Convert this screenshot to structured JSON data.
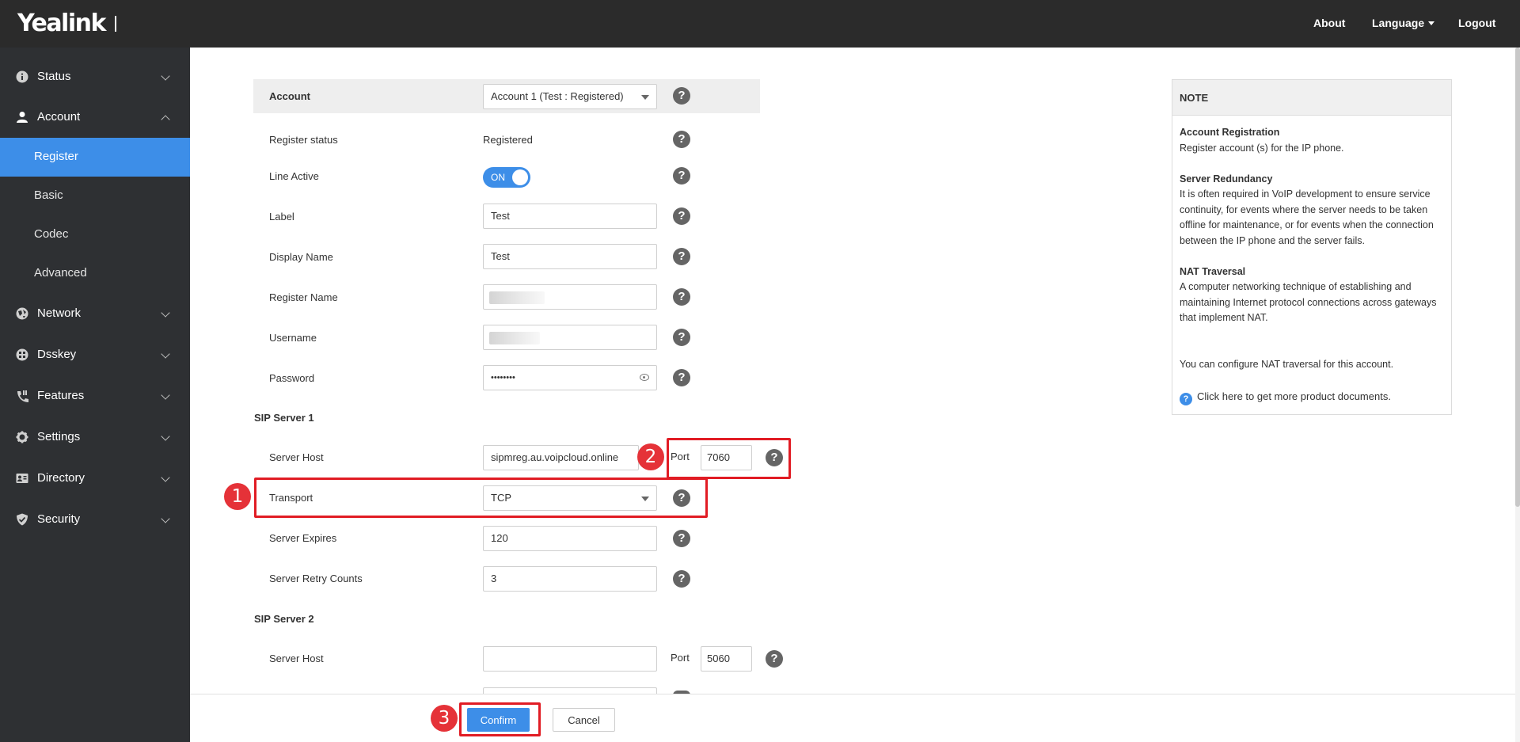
{
  "header": {
    "logo": "Yealink",
    "about": "About",
    "language": "Language",
    "logout": "Logout"
  },
  "sidebar": {
    "status": "Status",
    "account": "Account",
    "sub": {
      "register": "Register",
      "basic": "Basic",
      "codec": "Codec",
      "advanced": "Advanced"
    },
    "network": "Network",
    "dsskey": "Dsskey",
    "features": "Features",
    "settings": "Settings",
    "directory": "Directory",
    "security": "Security"
  },
  "form": {
    "account_label": "Account",
    "account_value": "Account 1 (Test : Registered)",
    "register_status_label": "Register status",
    "register_status_value": "Registered",
    "line_active_label": "Line Active",
    "line_active_value": "ON",
    "label_label": "Label",
    "label_value": "Test",
    "display_name_label": "Display Name",
    "display_name_value": "Test",
    "register_name_label": "Register Name",
    "username_label": "Username",
    "password_label": "Password",
    "password_value": "••••••••",
    "sip1_title": "SIP Server 1",
    "sip1_host_label": "Server Host",
    "sip1_host_value": "sipmreg.au.voipcloud.online",
    "port_label": "Port",
    "sip1_port_value": "7060",
    "transport_label": "Transport",
    "transport_value": "TCP",
    "expires_label": "Server Expires",
    "expires_value": "120",
    "retry_label": "Server Retry Counts",
    "retry_value": "3",
    "sip2_title": "SIP Server 2",
    "sip2_host_label": "Server Host",
    "sip2_host_value": "",
    "sip2_port_value": "5060",
    "help_glyph": "?"
  },
  "annotations": {
    "one": "1",
    "two": "2",
    "three": "3"
  },
  "buttons": {
    "confirm": "Confirm",
    "cancel": "Cancel"
  },
  "note": {
    "title": "NOTE",
    "reg_title": "Account Registration",
    "reg_text": "Register account (s) for the IP phone.",
    "red_title": "Server Redundancy",
    "red_text": "It is often required in VoIP development to ensure service continuity, for events where the server needs to be taken offline for maintenance, or for events when the connection between the IP phone and the server fails.",
    "nat_title": "NAT Traversal",
    "nat_text": "A computer networking technique of establishing and maintaining Internet protocol connections across gateways that implement NAT.",
    "nat_config": "You can configure NAT traversal for this account.",
    "docs_link": "Click here to get more product documents."
  },
  "colors": {
    "accent": "#3d8ee8",
    "sidebar_bg": "#2e3033",
    "header_bg": "#2b2b2b",
    "annotation_red": "#e11c24"
  }
}
